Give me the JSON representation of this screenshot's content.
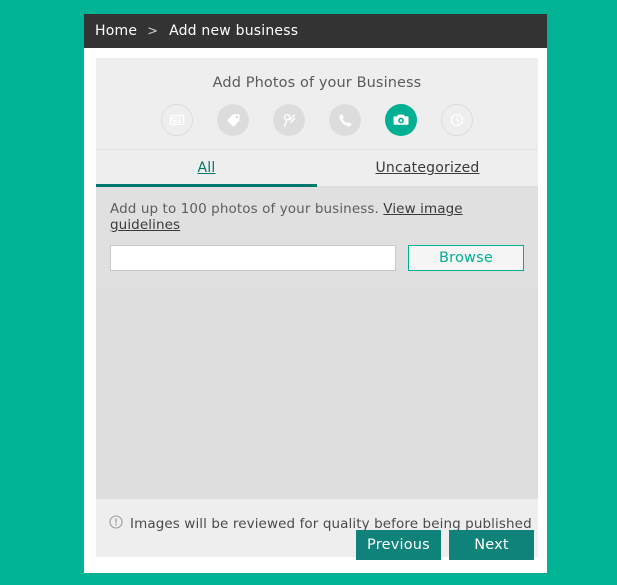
{
  "theme": {
    "page_background": "#00b394",
    "header_background": "#333333",
    "accent_teal": "#00b092",
    "accent_dark_teal": "#0f8279",
    "tab_active": "#00786b",
    "panel_background": "#eeeeee",
    "upload_strip_background": "#e0e0e0",
    "photo_area_background": "#dedede"
  },
  "breadcrumb": {
    "home_label": "Home",
    "separator": ">",
    "current_label": "Add new business"
  },
  "panel": {
    "title": "Add Photos of your Business"
  },
  "steps": [
    {
      "name": "business-card-icon",
      "label": "Business Info",
      "state": "inactive",
      "style": "hollow"
    },
    {
      "name": "tag-icon",
      "label": "Categories",
      "state": "inactive",
      "style": "filled"
    },
    {
      "name": "location-pin-icon",
      "label": "Location",
      "state": "inactive",
      "style": "filled"
    },
    {
      "name": "phone-icon",
      "label": "Contact",
      "state": "inactive",
      "style": "filled"
    },
    {
      "name": "camera-icon",
      "label": "Photos",
      "state": "active",
      "style": "filled"
    },
    {
      "name": "clock-icon",
      "label": "Hours",
      "state": "inactive",
      "style": "hollow"
    }
  ],
  "tabs": [
    {
      "label": "All",
      "active": true
    },
    {
      "label": "Uncategorized",
      "active": false
    }
  ],
  "upload": {
    "hint_text": "Add up to 100 photos of your business.",
    "guidelines_link": "View image guidelines",
    "file_value": "",
    "file_placeholder": "",
    "browse_label": "Browse"
  },
  "note": {
    "icon": "info-circle-icon",
    "text": "Images will be reviewed for quality before being published"
  },
  "footer": {
    "previous_label": "Previous",
    "next_label": "Next"
  }
}
